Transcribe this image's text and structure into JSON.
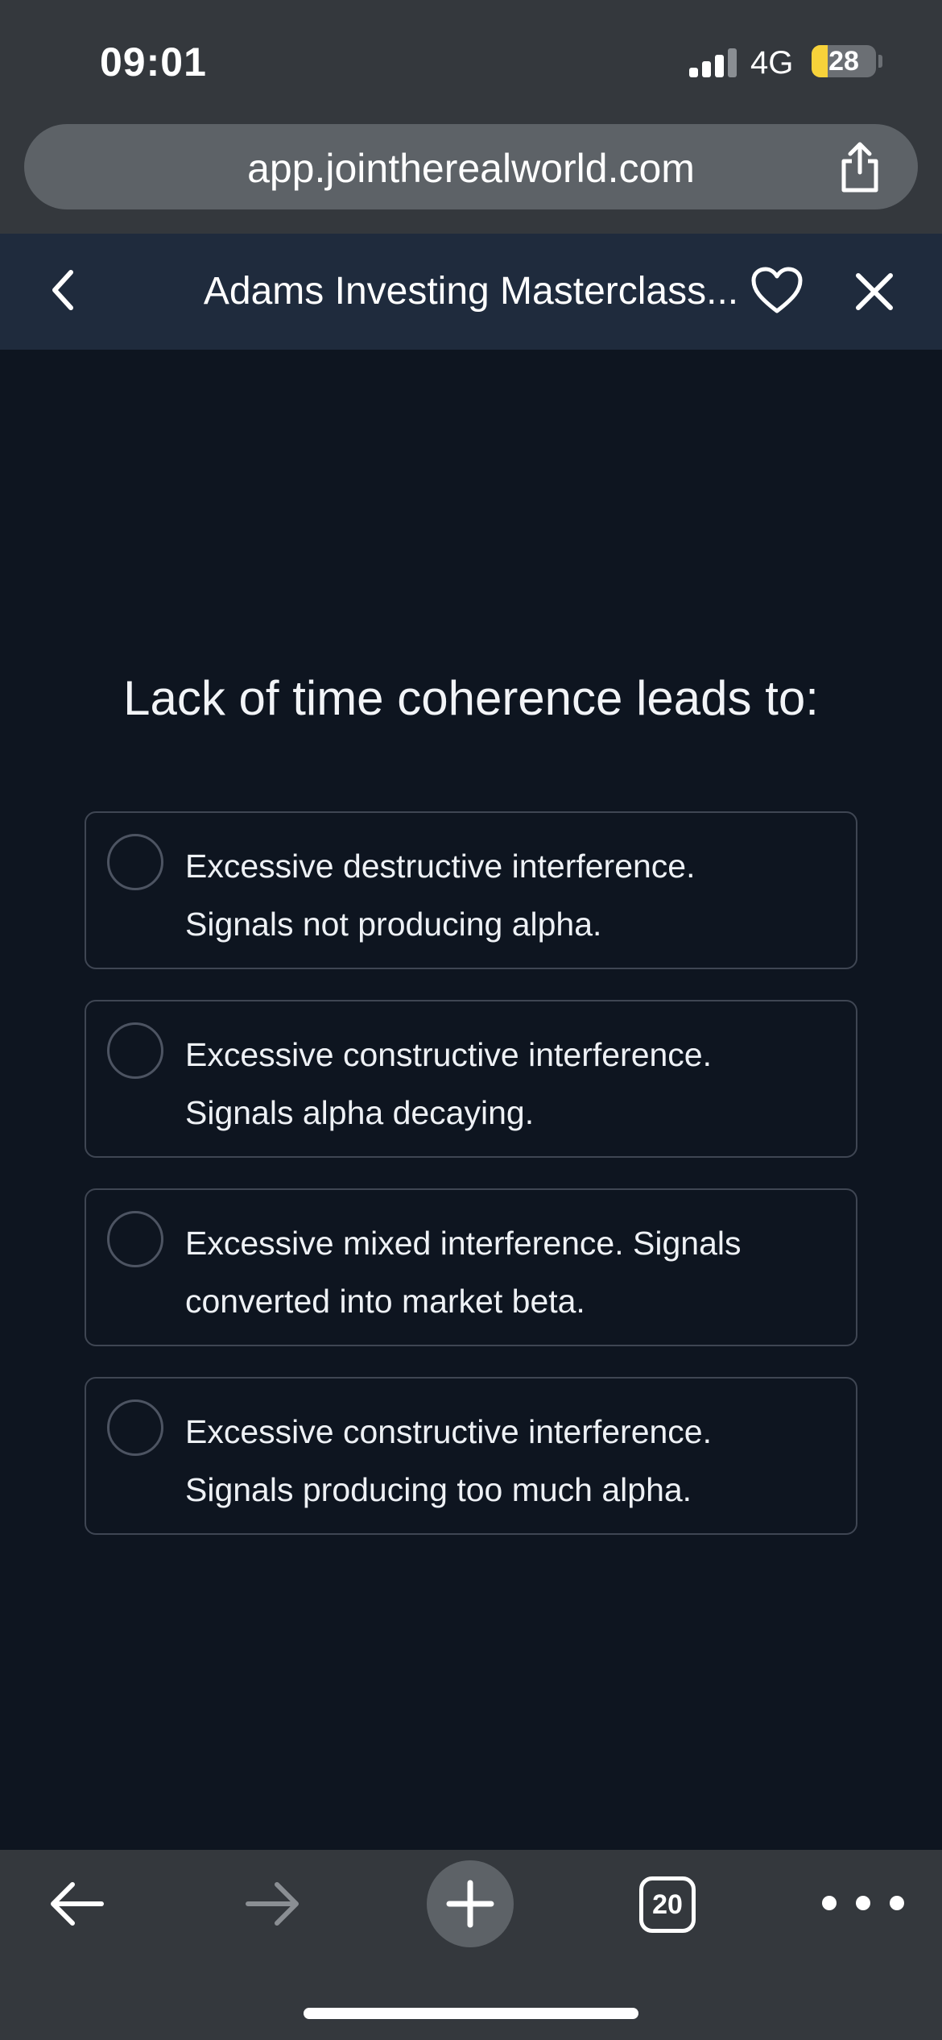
{
  "status_bar": {
    "time": "09:01",
    "network": "4G",
    "battery": "28"
  },
  "browser": {
    "url": "app.jointherealworld.com",
    "tab_count": "20"
  },
  "app_header": {
    "title": "Adams Investing Masterclass..."
  },
  "quiz": {
    "question": "Lack of time coherence leads to:",
    "options": [
      {
        "line1": "Excessive destructive interference.",
        "line2": "Signals not producing alpha."
      },
      {
        "line1": "Excessive constructive interference.",
        "line2": "Signals alpha decaying."
      },
      {
        "line1": "Excessive mixed interference. Signals",
        "line2": "converted into market beta."
      },
      {
        "line1": "Excessive constructive interference.",
        "line2": "Signals producing too much alpha."
      }
    ]
  },
  "colors": {
    "page_bg": "#0e1520",
    "header_bg": "#1f2b3d",
    "chrome_bg": "#34383d",
    "option_border": "#3f4653",
    "battery_fill": "#f7d23a"
  },
  "icons": {
    "back": "chevron-left-icon",
    "favorite": "heart-icon",
    "close": "close-icon",
    "share": "share-icon",
    "nav_back": "arrow-left-icon",
    "nav_forward": "arrow-right-icon",
    "new_tab": "plus-icon",
    "more": "ellipsis-icon"
  }
}
